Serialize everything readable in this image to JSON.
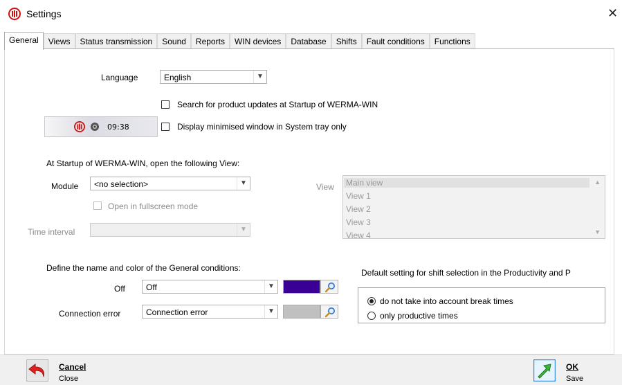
{
  "window": {
    "title": "Settings"
  },
  "tabs": [
    {
      "label": "General",
      "active": true
    },
    {
      "label": "Views"
    },
    {
      "label": "Status transmission"
    },
    {
      "label": "Sound"
    },
    {
      "label": "Reports"
    },
    {
      "label": "WIN devices"
    },
    {
      "label": "Database"
    },
    {
      "label": "Shifts"
    },
    {
      "label": "Fault conditions"
    },
    {
      "label": "Functions"
    }
  ],
  "general": {
    "language_label": "Language",
    "language_value": "English",
    "search_updates_label": "Search for product updates at Startup of WERMA-WIN",
    "search_updates_checked": false,
    "tray_only_label": "Display minimised window in System tray only",
    "tray_only_checked": false,
    "tray_preview_time": "09:38",
    "startup_heading": "At Startup of WERMA-WIN, open the following View:",
    "module_label": "Module",
    "module_value": "<no selection>",
    "fullscreen_label": "Open in fullscreen mode",
    "time_interval_label": "Time interval",
    "time_interval_value": "",
    "view_label": "View",
    "views": [
      "Main view",
      "View 1",
      "View 2",
      "View 3",
      "View 4"
    ],
    "selected_view": "Main view",
    "conditions_heading": "Define the name and color of the General conditions:",
    "off_label": "Off",
    "off_value": "Off",
    "off_color": "#3a0096",
    "conn_error_label": "Connection error",
    "conn_error_value": "Connection error",
    "conn_error_color": "#c0c0c0",
    "shift_heading": "Default setting for shift selection in the Productivity and P",
    "radio_break_label": "do not take into account break times",
    "radio_productive_label": "only productive times",
    "radio_selected": "break"
  },
  "footer": {
    "cancel_title": "Cancel",
    "cancel_sub": "Close",
    "ok_title": "OK",
    "ok_sub": "Save"
  },
  "icons": {
    "app": "werma-logo-icon",
    "cancel": "undo-arrow-icon",
    "ok": "green-arrow-icon",
    "picker": "magnifier-icon"
  }
}
